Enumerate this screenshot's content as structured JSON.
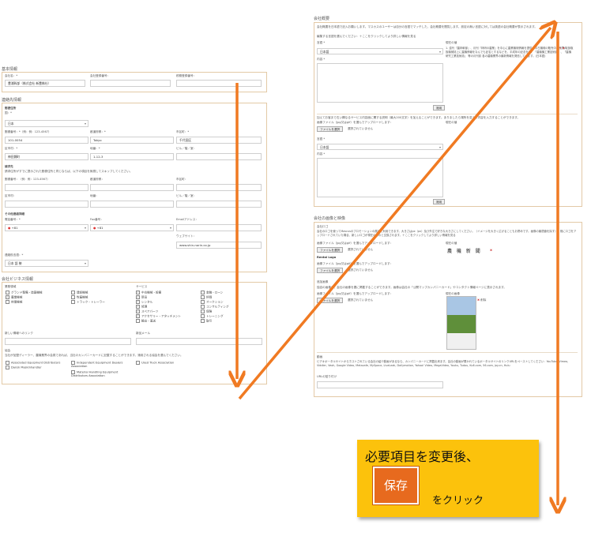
{
  "left": {
    "basic": {
      "title": "基本情報",
      "company_label": "会社名：*",
      "company_value": "豊浦幹部（株式会社 新豊株社）",
      "reg_label": "会社登録番号：",
      "tax_label": "税務登録番号："
    },
    "contact": {
      "title": "連絡先情報",
      "postal_title": "郵便住所",
      "country_label": "国：*",
      "country_value": "日本",
      "zip_label": "郵便番号：*（例：例：123-4567）",
      "zip_value": "101-0054",
      "pref_label": "都道府県：*",
      "pref_value": "Tokyo",
      "city_label": "市区町：*",
      "city_value": "千代田区",
      "ward_label": "区市村：*",
      "ward_value": "神田錦町",
      "addr_label": "地番：*",
      "addr_value": "1-12-3",
      "bldg_label": "ビル／階／室：",
      "billing_title": "請求先",
      "billing_note": "請求住所がすでに提示された郵便住所と同じならば、以下の項目を無視してスキップしてください。",
      "b_zip_label": "郵便番号：（例：例：123-4567）",
      "b_pref_label": "都道府県：",
      "b_city_label": "市区町：",
      "b_ward_label": "区市村：",
      "b_addr_label": "地番：",
      "b_bldg_label": "ビル／階／室：",
      "other_title": "その他連絡詳細",
      "phone_label": "電話番号：*",
      "phone_value": "+81",
      "fax_label": "Fax番号：",
      "fax_value": "+81",
      "email_label": "Emailアドレス：",
      "web_label": "ウェブサイト：",
      "web_value": "www.shin-norin.co.jp",
      "lang_label": "連絡役言語：*",
      "lang_value": "日本 語 勢"
    },
    "business": {
      "title": "会社ビジネス情報",
      "sector_label": "業務領域",
      "col1": [
        "グランド整備・造園機械",
        "農業機械",
        "林業機械"
      ],
      "col1_checked": [
        false,
        true,
        false
      ],
      "col2": [
        "建設機械",
        "牧畜機械",
        "トラック・トレーラー"
      ],
      "col2_checked": [
        false,
        false,
        false
      ],
      "service_label": "サービス",
      "col3": [
        "中古機械・設備",
        "新品",
        "レンタル",
        "修理",
        "スペアパーツ",
        "アクセサリー・アタッチメント",
        "輸出・運送"
      ],
      "col3_checked": [
        true,
        true,
        true,
        true,
        true,
        true,
        false
      ],
      "col4": [
        "金融・ローン",
        "評価",
        "オークション",
        "コンサルティング",
        "保険",
        "トレーニング",
        "取引"
      ],
      "col4_checked": [
        false,
        false,
        false,
        false,
        false,
        false,
        false
      ],
      "new_link_label": "新しい情報へのリンク",
      "sales_email_label": "新品メール",
      "assoc_label": "協会",
      "assoc_note": "当社が加盟ディーラー、農機業界の会員であれば、当社のカンパニーカードに記載することができます。適用される協会を選んでください。",
      "assoc_items": [
        "Associated Equipment Distributors",
        "Independent Equipment Dealers Association",
        "Used Truck Association",
        "Dansk Maskinhandler",
        "Material Handling Equipment Distributors Association"
      ]
    }
  },
  "right": {
    "overview": {
      "title": "会社概要",
      "note": "会社概要を日本語で記入お願いします。マスカスのユーザーは自分の言語でマッチした、会社概要を閲覧します。設定の無い言語に対しては英語の会社概要が表示されます。",
      "edit_label": "編集する言語を選んでください：＋ここをクリックしてより詳しい情報を見る",
      "lang_label": "言語 *",
      "lang_value": "日本語",
      "content_label": "内容 *",
      "current_label": "現在の値",
      "current_text": "1. 遠刊『農林幹部』、月刊『林研の農業』を中心に農業機械情報を提供、中古機械の販売中、売買/取扱取扱機械誌上に農機情報をなんでも記名とするなどを、平成年の記念を前、「農機機工業技術誌」、「農機研究工業技術誌」 等の月刊誌 各の農機業界の最新情報を発信しています。(日本語)",
      "apply_btn": "適用",
      "faq_note": "加えてお客まで右い構なるサービス内容面に関する説明（最大200文字）を加えることができます。ありましたら場所を変えて内容を入力することができます。",
      "upload_label": "画像ファイル（jpg又はgif）を選んでアップロードします：",
      "file_btn": "ファイルを選択",
      "no_file": "選択されていません",
      "lang2_label": "言語 *",
      "lang2_value": "日本語",
      "content2_label": "内容 *",
      "apply2_btn": "適用"
    },
    "media": {
      "title": "会社の画像と映像",
      "logo_label": "会社ロゴ",
      "logo_note": "会社のロゴを使ってMascusのプロモーションの展示に利用できます。大きさはpx（px）及び外注で好きな大きさにしてください。（イメージを大きく広げることもお薦めです。画像の最適値を探す）。既にロゴをアップロードされていた場合、新しいロゴが現在のものと交換されます。＋ここをクリックしてより詳しい情報を見る",
      "upload_label": "画像ファイル（jpg又はgif）を選んでアップロードします：",
      "file_btn": "ファイルを選択",
      "no_file": "選択されていません",
      "current_label": "現在の値",
      "logo_text": "農 機 新 聞",
      "delete_label": "削除",
      "rental_title": "Rental Logo",
      "rental_upload": "画像ファイル（jpg又はgif）を選んでアップロードします：",
      "rental_file_btn": "ファイルを選択",
      "rental_no_file": "選択されていません",
      "cover_title": "追加画像",
      "cover_note": "独自の画像を、会社の画像を要に掲載することができます。画像は会社の「公開マップカンパニーカード」やコンタクト情報ページに表示されます。",
      "cover_upload": "画像ファイル（jpg又はgif）を選んでアップロードします：",
      "cover_file_btn": "ファイルを選択",
      "cover_no_file": "選択されていません",
      "cover_current": "現在の画像",
      "cover_delete": "削除",
      "video_title": "動画",
      "video_note": "ビデオポータルサイトからホストされている会社の紹介動画があるなら、カンパニーカードに掲載出来ます。会社の動画が置かれているポータルサイトのリンクURLをペーストしてください：YouTube, Vimeo, Viddler, Veoh, Google Video, Metacafe, MySpace, LiveLeak, Dailymotion, Yahoo! Video, MegaVideo, Youku, Tudou, Ku6.com, 56.com, joy.cn, Hulu",
      "url_label": "URLの貼り付け"
    }
  },
  "callout": {
    "line1": "必要項目を変更後、",
    "save_btn": "保存",
    "line2": "をクリック"
  },
  "colors": {
    "arrow": "#f07a22",
    "callout_bg": "#fcc20c",
    "save_btn": "#e76a1e",
    "panel_border": "#e3c9a6"
  }
}
